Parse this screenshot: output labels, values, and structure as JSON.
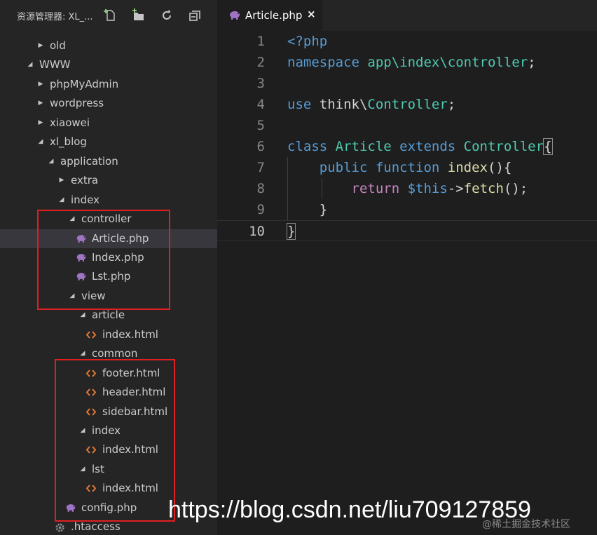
{
  "explorer": {
    "title": "资源管理器: XL_...",
    "icons": [
      "new-file-icon",
      "new-folder-icon",
      "refresh-icon",
      "collapse-all-icon"
    ]
  },
  "tree": [
    {
      "label": "old",
      "depth": 1,
      "type": "folder",
      "expanded": false
    },
    {
      "label": "WWW",
      "depth": 0,
      "type": "folder",
      "expanded": true
    },
    {
      "label": "phpMyAdmin",
      "depth": 1,
      "type": "folder",
      "expanded": false
    },
    {
      "label": "wordpress",
      "depth": 1,
      "type": "folder",
      "expanded": false
    },
    {
      "label": "xiaowei",
      "depth": 1,
      "type": "folder",
      "expanded": false
    },
    {
      "label": "xl_blog",
      "depth": 1,
      "type": "folder",
      "expanded": true
    },
    {
      "label": "application",
      "depth": 2,
      "type": "folder",
      "expanded": true
    },
    {
      "label": "extra",
      "depth": 3,
      "type": "folder",
      "expanded": false
    },
    {
      "label": "index",
      "depth": 3,
      "type": "folder",
      "expanded": true
    },
    {
      "label": "controller",
      "depth": 4,
      "type": "folder",
      "expanded": true
    },
    {
      "label": "Article.php",
      "depth": 5,
      "type": "php",
      "selected": true
    },
    {
      "label": "Index.php",
      "depth": 5,
      "type": "php"
    },
    {
      "label": "Lst.php",
      "depth": 5,
      "type": "php"
    },
    {
      "label": "view",
      "depth": 4,
      "type": "folder",
      "expanded": true
    },
    {
      "label": "article",
      "depth": 5,
      "type": "folder",
      "expanded": true
    },
    {
      "label": "index.html",
      "depth": 6,
      "type": "html"
    },
    {
      "label": "common",
      "depth": 5,
      "type": "folder",
      "expanded": true
    },
    {
      "label": "footer.html",
      "depth": 6,
      "type": "html"
    },
    {
      "label": "header.html",
      "depth": 6,
      "type": "html"
    },
    {
      "label": "sidebar.html",
      "depth": 6,
      "type": "html"
    },
    {
      "label": "index",
      "depth": 5,
      "type": "folder",
      "expanded": true
    },
    {
      "label": "index.html",
      "depth": 6,
      "type": "html"
    },
    {
      "label": "lst",
      "depth": 5,
      "type": "folder",
      "expanded": true
    },
    {
      "label": "index.html",
      "depth": 6,
      "type": "html"
    },
    {
      "label": "config.php",
      "depth": 4,
      "type": "php"
    },
    {
      "label": ".htaccess",
      "depth": 3,
      "type": "config"
    }
  ],
  "editor": {
    "tab": {
      "label": "Article.php",
      "close": "×"
    },
    "active_line": 10,
    "lines": [
      [
        {
          "t": "<?php",
          "c": "#569cd6"
        }
      ],
      [
        {
          "t": "namespace ",
          "c": "#569cd6"
        },
        {
          "t": "app\\index\\controller",
          "c": "#4ec9b0"
        },
        {
          "t": ";",
          "c": "#d4d4d4"
        }
      ],
      [],
      [
        {
          "t": "use ",
          "c": "#569cd6"
        },
        {
          "t": "think\\",
          "c": "#d4d4d4"
        },
        {
          "t": "Controller",
          "c": "#4ec9b0"
        },
        {
          "t": ";",
          "c": "#d4d4d4"
        }
      ],
      [],
      [
        {
          "t": "class ",
          "c": "#569cd6"
        },
        {
          "t": "Article ",
          "c": "#4ec9b0"
        },
        {
          "t": "extends ",
          "c": "#569cd6"
        },
        {
          "t": "Controller",
          "c": "#4ec9b0"
        },
        {
          "t": "{",
          "c": "#d4d4d4",
          "b": true
        }
      ],
      [
        {
          "t": "    ",
          "c": "#d4d4d4"
        },
        {
          "t": "public ",
          "c": "#569cd6"
        },
        {
          "t": "function ",
          "c": "#569cd6"
        },
        {
          "t": "index",
          "c": "#dcdcaa"
        },
        {
          "t": "(){",
          "c": "#d4d4d4"
        }
      ],
      [
        {
          "t": "        ",
          "c": "#d4d4d4"
        },
        {
          "t": "return ",
          "c": "#c586c0"
        },
        {
          "t": "$this",
          "c": "#569cd6"
        },
        {
          "t": "->",
          "c": "#d4d4d4"
        },
        {
          "t": "fetch",
          "c": "#dcdcaa"
        },
        {
          "t": "();",
          "c": "#d4d4d4"
        }
      ],
      [
        {
          "t": "    }",
          "c": "#d4d4d4"
        }
      ],
      [
        {
          "t": "}",
          "c": "#d4d4d4",
          "b": true
        }
      ]
    ]
  },
  "watermark": "https://blog.csdn.net/liu709127859",
  "watermark_sub": "@稀土掘金技术社区",
  "colors": {
    "selection": "#37373d",
    "highlight_box": "#e02020",
    "php_icon": "#a074c4",
    "html_icon": "#e37933"
  }
}
